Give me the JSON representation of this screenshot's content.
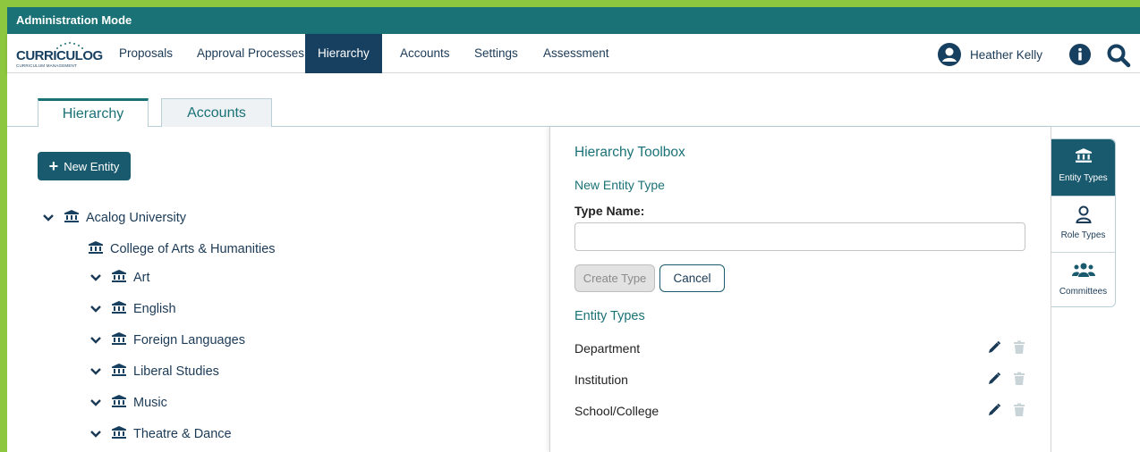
{
  "admin_bar": {
    "title": "Administration Mode"
  },
  "logo": {
    "main": "CURRICULOG",
    "sub": "CURRICULUM MANAGEMENT"
  },
  "nav": {
    "items": [
      {
        "label": "Proposals"
      },
      {
        "label": "Approval Processes"
      },
      {
        "label": "Hierarchy",
        "active": true
      },
      {
        "label": "Accounts"
      },
      {
        "label": "Settings"
      },
      {
        "label": "Assessment"
      }
    ],
    "user_name": "Heather Kelly",
    "icons": [
      "user-avatar-icon",
      "info-icon",
      "search-icon"
    ]
  },
  "tabs": [
    {
      "label": "Hierarchy",
      "active": true
    },
    {
      "label": "Accounts",
      "active": false
    }
  ],
  "left_panel": {
    "new_entity_label": "New Entity",
    "tree": [
      {
        "label": "Acalog University",
        "expanded": true,
        "level": 0
      },
      {
        "label": "College of Arts & Humanities",
        "level": 1,
        "has_chevron": false
      },
      {
        "label": "Art",
        "level": 1,
        "has_chevron": true
      },
      {
        "label": "English",
        "level": 1,
        "has_chevron": true
      },
      {
        "label": "Foreign Languages",
        "level": 1,
        "has_chevron": true
      },
      {
        "label": "Liberal Studies",
        "level": 1,
        "has_chevron": true
      },
      {
        "label": "Music",
        "level": 1,
        "has_chevron": true
      },
      {
        "label": "Theatre & Dance",
        "level": 1,
        "has_chevron": true
      }
    ]
  },
  "toolbox": {
    "title": "Hierarchy Toolbox",
    "subtitle": "New Entity Type",
    "type_name_label": "Type Name:",
    "type_name_value": "",
    "type_name_placeholder": "",
    "create_label": "Create Type",
    "cancel_label": "Cancel",
    "entity_types_heading": "Entity Types",
    "entity_types": [
      {
        "name": "Department"
      },
      {
        "name": "Institution"
      },
      {
        "name": "School/College"
      }
    ]
  },
  "side_tabs": [
    {
      "label": "Entity Types",
      "icon": "building-icon",
      "active": true
    },
    {
      "label": "Role Types",
      "icon": "person-icon",
      "active": false
    },
    {
      "label": "Committees",
      "icon": "group-icon",
      "active": false
    }
  ],
  "colors": {
    "frame_green": "#8dc63f",
    "admin_bar_teal": "#1a7276",
    "nav_active": "#173f5f",
    "accent_teal": "#1a7276",
    "button_dark": "#1a5a6e"
  }
}
